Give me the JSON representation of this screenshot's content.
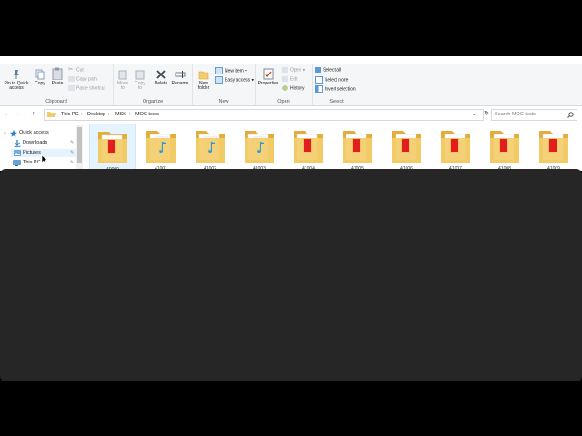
{
  "ribbon": {
    "clipboard": {
      "label": "Clipboard",
      "pin": "Pin to Quick access",
      "copy": "Copy",
      "paste": "Paste",
      "cut": "Cut",
      "copy_path": "Copy path",
      "paste_shortcut": "Paste shortcut"
    },
    "organize": {
      "label": "Organize",
      "move_to": "Move to",
      "copy_to": "Copy to",
      "delete": "Delete",
      "rename": "Rename"
    },
    "new": {
      "label": "New",
      "new_folder": "New folder",
      "new_item": "New item",
      "easy_access": "Easy access"
    },
    "open": {
      "label": "Open",
      "properties": "Properties",
      "open": "Open",
      "edit": "Edit",
      "history": "History"
    },
    "select": {
      "label": "Select",
      "select_all": "Select all",
      "select_none": "Select none",
      "invert_selection": "Invert selection"
    }
  },
  "address": {
    "crumbs": [
      "This PC",
      "Desktop",
      "MSK",
      "MOC tests"
    ],
    "search_placeholder": "Search MOC tests"
  },
  "nav": {
    "quick_access": "Quick access",
    "downloads": "Downloads",
    "pictures": "Pictures",
    "this_pc": "This PC"
  },
  "files": [
    {
      "name": "40000",
      "kind": "pdf"
    },
    {
      "name": "41001",
      "kind": "audio"
    },
    {
      "name": "41002",
      "kind": "audio"
    },
    {
      "name": "41003",
      "kind": "audio"
    },
    {
      "name": "41004",
      "kind": "pdf"
    },
    {
      "name": "41005",
      "kind": "pdf"
    },
    {
      "name": "41006",
      "kind": "pdf"
    },
    {
      "name": "41007",
      "kind": "pdf"
    },
    {
      "name": "41008",
      "kind": "pdf"
    },
    {
      "name": "41009",
      "kind": "pdf"
    }
  ],
  "colors": {
    "accent": "#1979ca",
    "folder": "#f3cd6b",
    "folder_dark": "#e3ad3c",
    "pdf_red": "#e11d1d",
    "audio_blue": "#2a9bd8"
  }
}
